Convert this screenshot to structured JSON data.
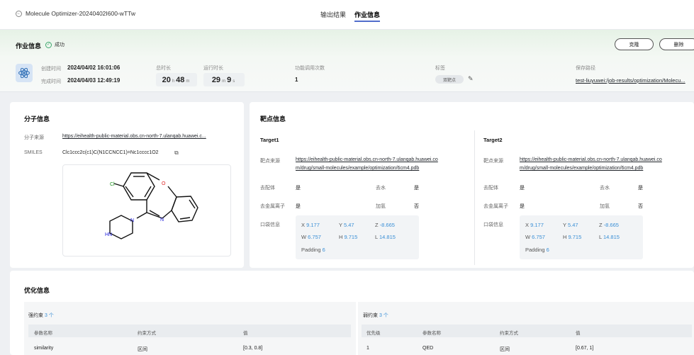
{
  "header": {
    "back_label": "Molecule Optimizer-20240402I600-wTTw",
    "tabs": [
      {
        "label": "输出结果",
        "active": false
      },
      {
        "label": "作业信息",
        "active": true
      }
    ]
  },
  "job": {
    "title": "作业信息",
    "status": "成功",
    "clone_label": "克隆",
    "delete_label": "删除",
    "created_label": "创建时间",
    "created_value": "2024/04/02 16:01:06",
    "finished_label": "完成时间",
    "finished_value": "2024/04/03 12:49:19",
    "total_duration_label": "总时长",
    "total_duration": {
      "h": "20",
      "h_unit": "h",
      "m": "48",
      "m_unit": "m"
    },
    "run_duration_label": "运行时长",
    "run_duration": {
      "m": "29",
      "m_unit": "m",
      "s": "9",
      "s_unit": "s"
    },
    "calls_label": "功能调用次数",
    "calls_value": "1",
    "tags_label": "标签",
    "tag": "双靶点",
    "save_path_label": "保存路径",
    "save_path": "test-liuyuwei:/job-results/optimization/Molecu..."
  },
  "molecule": {
    "title": "分子信息",
    "source_label": "分子来源",
    "source_value": "https://eihealth-public-material.obs.cn-north-7.ulanqab.huawei.c...",
    "smiles_label": "SMILES",
    "smiles_value": "Clc1ccc2c(c1)C(N1CCNCC1)=Nc1cccc1O2",
    "atom_cl": "Cl",
    "atom_o": "O",
    "atom_n": "N",
    "atom_hn": "HN"
  },
  "targets": {
    "title": "靶点信息",
    "source_label": "靶点来源",
    "ligand_label": "去配体",
    "water_label": "去水",
    "metal_label": "去金属离子",
    "hydrogen_label": "加氢",
    "pocket_label": "口袋信息",
    "padding_label": "Padding",
    "items": [
      {
        "name": "Target1",
        "source_line1": "https://eihealth-public-material.obs.cn-north-7.ulanqab.huawei.co",
        "source_line2": "m/drug/small-molecules/example/optimization/6cm4.pdb",
        "ligand": "是",
        "water": "是",
        "metal": "是",
        "hydrogen": "否",
        "pocket": {
          "X": "9.177",
          "Y": "5.47",
          "Z": "-8.665",
          "W": "6.757",
          "H": "9.715",
          "L": "14.815",
          "padding": "6"
        }
      },
      {
        "name": "Target2",
        "source_line1": "https://eihealth-public-material.obs.cn-north-7.ulanqab.huawei.co",
        "source_line2": "m/drug/small-molecules/example/optimization/6cm4.pdb",
        "ligand": "是",
        "water": "是",
        "metal": "是",
        "hydrogen": "否",
        "pocket": {
          "X": "9.177",
          "Y": "5.47",
          "Z": "-8.665",
          "W": "6.757",
          "H": "9.715",
          "L": "14.815",
          "padding": "6"
        }
      }
    ]
  },
  "optimization": {
    "title": "优化信息",
    "strong": {
      "label": "强约束",
      "count": "3 个",
      "headers": [
        "参数名称",
        "约束方式",
        "值"
      ],
      "rows": [
        [
          "similarity",
          "区间",
          "[0.3, 0.8]"
        ]
      ]
    },
    "weak": {
      "label": "弱约束",
      "count": "3 个",
      "headers": [
        "优先级",
        "参数名称",
        "约束方式",
        "值"
      ],
      "rows": [
        [
          "1",
          "QED",
          "区间",
          "[0.67, 1]"
        ]
      ]
    }
  }
}
